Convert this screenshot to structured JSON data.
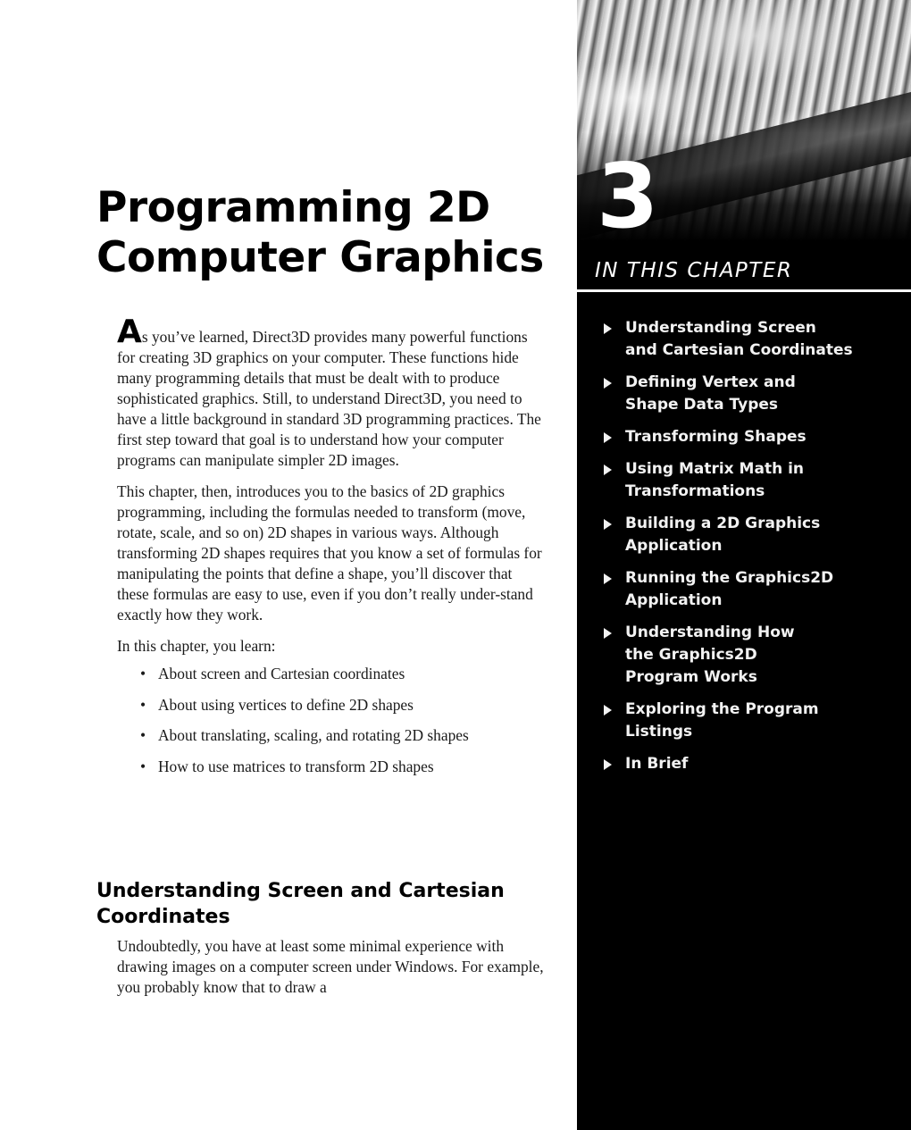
{
  "chapter": {
    "number": "3",
    "title_lines": [
      "Programming 2D",
      "Computer Graphics"
    ],
    "in_this_chapter_label": "IN THIS CHAPTER",
    "topics": [
      "Understanding Screen and Cartesian Coordinates",
      "Defining Vertex and Shape Data Types",
      "Transforming Shapes",
      "Using Matrix Math in Transformations",
      "Building a 2D Graphics Application",
      "Running the Graphics2D Application",
      "Understanding How the Graphics2D Program Works",
      "Exploring the Program Listings",
      "In Brief"
    ]
  },
  "intro": {
    "dropcap": "A",
    "paragraph1_rest": "s you’ve learned, Direct3D provides many powerful functions for creating 3D graphics on your computer. These functions hide many programming details that must be dealt with to produce sophisticated graphics. Still, to understand Direct3D, you need to have a little background in standard 3D programming practices. The first step toward that goal is to understand how your computer programs can manipulate simpler 2D images.",
    "paragraph2": "This chapter, then, introduces you to the basics of 2D graphics programming, including the formulas needed to transform (move, rotate, scale, and so on) 2D shapes in various ways. Although transforming 2D shapes requires that you know a set of formulas for manipulating the points that define a shape, you’ll discover that these formulas are easy to use, even if you don’t really under-stand exactly how they work.",
    "learn_lead": "In this chapter, you learn:",
    "learn_items": [
      "About screen and Cartesian coordinates",
      "About using vertices to define 2D shapes",
      "About translating, scaling, and rotating 2D shapes",
      "How to use matrices to transform 2D shapes"
    ],
    "bullet_glyph": "•"
  },
  "section": {
    "heading": "Understanding Screen and Cartesian Coordinates",
    "body": "Undoubtedly, you have at least some minimal experience with drawing images on a computer screen under Windows. For example, you probably know that to draw a"
  },
  "decor": {
    "photo": "grayscale-chrome-machinery-photo",
    "topic_marker_icon": "right-triangle-icon"
  }
}
